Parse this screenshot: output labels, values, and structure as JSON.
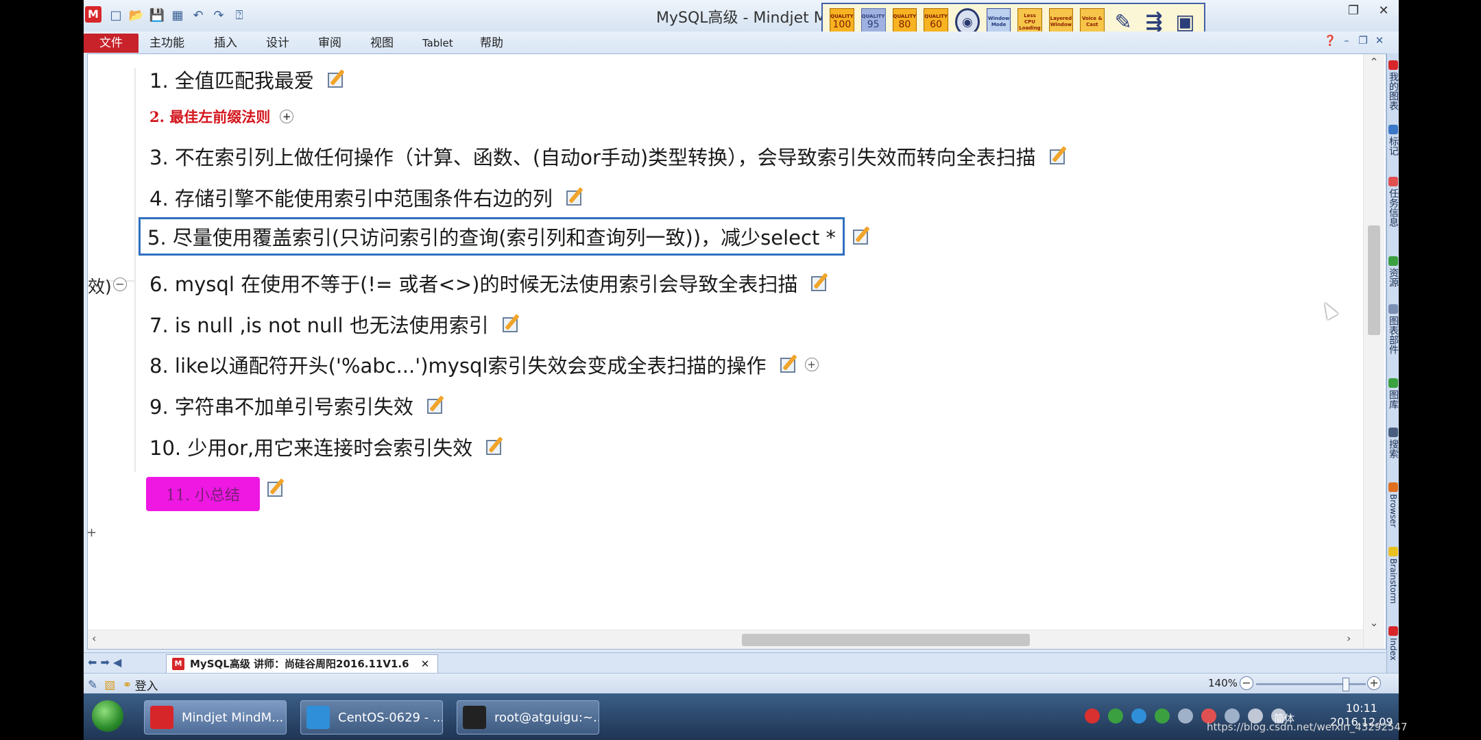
{
  "window": {
    "title": "MySQL高级 - Mindjet M"
  },
  "ribbon": {
    "tabs": [
      "文件",
      "主功能",
      "插入",
      "设计",
      "审阅",
      "视图",
      "Tablet",
      "帮助"
    ]
  },
  "toolbar": {
    "quality": [
      {
        "label": "QUALITY",
        "value": "100"
      },
      {
        "label": "QUALITY",
        "value": "95"
      },
      {
        "label": "QUALITY",
        "value": "80"
      },
      {
        "label": "QUALITY",
        "value": "60"
      }
    ],
    "buttons": [
      "Window Mode",
      "Less CPU Loading",
      "Layered Window",
      "Voice & Cast"
    ]
  },
  "topics": {
    "t1": "1. 全值匹配我最爱",
    "t2": "2. 最佳左前缀法则",
    "t3": "3. 不在索引列上做任何操作（计算、函数、(自动or手动)类型转换），会导致索引失效而转向全表扫描",
    "t4": "4. 存储引擎不能使用索引中范围条件右边的列",
    "t5": "5. 尽量使用覆盖索引(只访问索引的查询(索引列和查询列一致))，减少select *",
    "t6": "6. mysql 在使用不等于(!= 或者<>)的时候无法使用索引会导致全表扫描",
    "t7": "7. is null ,is not null 也无法使用索引",
    "t8": "8. like以通配符开头('%abc...')mysql索引失效会变成全表扫描的操作",
    "t9": "9. 字符串不加单引号索引失效",
    "t10": "10. 少用or,用它来连接时会索引失效",
    "t11": "11. 小总结",
    "left_fragment": "效)"
  },
  "dock": {
    "items": [
      "我的图表",
      "标记",
      "任务信息",
      "资源",
      "图表部件",
      "图库",
      "搜索",
      "Browser",
      "Brainstorm",
      "Index"
    ]
  },
  "sheet": {
    "tab_label": "MySQL高级 讲师：尚硅谷周阳2016.11V1.6"
  },
  "statusbar": {
    "login": "登入",
    "zoom": "140%"
  },
  "taskbar": {
    "tasks": [
      "Mindjet MindM...",
      "CentOS-0629 - ...",
      "root@atguigu:~..."
    ],
    "lang": "简体",
    "time": "10:11",
    "date": "2016.12.09"
  },
  "watermark": "https://blog.csdn.net/weixin_43292547"
}
